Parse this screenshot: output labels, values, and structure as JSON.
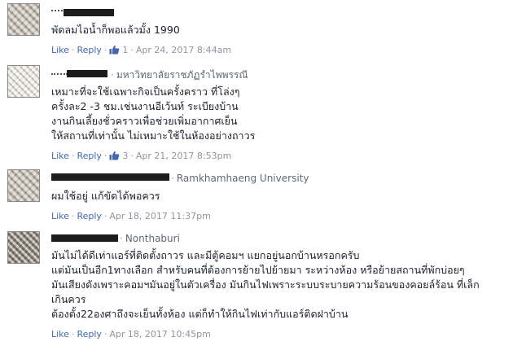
{
  "ui": {
    "like": "Like",
    "reply": "Reply",
    "dot": "·"
  },
  "comments": [
    {
      "affiliation": "",
      "lines": [
        "พัดลมไอน้ำก็พอแล้วมั้ง 1990"
      ],
      "likes": "1",
      "date": "Apr 24, 2017 8:44am"
    },
    {
      "affiliation": "มหาวิทยาลัยราชภัฏรำไพพรรณี",
      "lines": [
        "เหมาะที่จะใช้เฉพาะกิจเป็นครั้งคราว ที่โล่งๆ",
        "ครั้งละ2 -3 ชม.เช่นงานอีเว้นท์ ระเบียงบ้าน",
        "งานกินเลี้ยงชั่วคราวเพื่อช่วยเพิ่มอากาศเย็น",
        "ให้สถานที่เท่านั้น ไม่เหมาะใช้ในห้องอย่างถาวร"
      ],
      "likes": "3",
      "date": "Apr 21, 2017 8:53pm"
    },
    {
      "affiliation": "Ramkhamhaeng University",
      "lines": [
        "ผมใช้อยู่ แก้ขัดได้พอควร"
      ],
      "likes": "",
      "date": "Apr 18, 2017 11:37pm"
    },
    {
      "affiliation": "Nonthaburi",
      "lines": [
        "มันไม่ได้ดีเท่าแอร์ที่ติดตั้งถาวร และมีตู้คอมฯ แยกอยู่นอกบ้านหรอกครับ",
        "แต่มันเป็นอีก1ทางเลือก สำหรับคนที่ต้องการย้ายไปย้ายมา ระหว่างห้อง หรือย้ายสถานที่พักบ่อยๆ",
        "มันเสียงดังเพราะคอมฯมันอยู่ในตัวเครื่อง มันกินไฟเพราะระบบระบายความร้อนของคอยล์ร้อน ที่เล็ก",
        "เกินควร",
        "ต้องตั้ง22องศาถึงจะเย็นทั้งห้อง แต่ก็ทำให้กินไฟเท่ากับแอร์ติดฝาบ้าน"
      ],
      "likes": "",
      "date": "Apr 18, 2017 10:45pm"
    }
  ]
}
